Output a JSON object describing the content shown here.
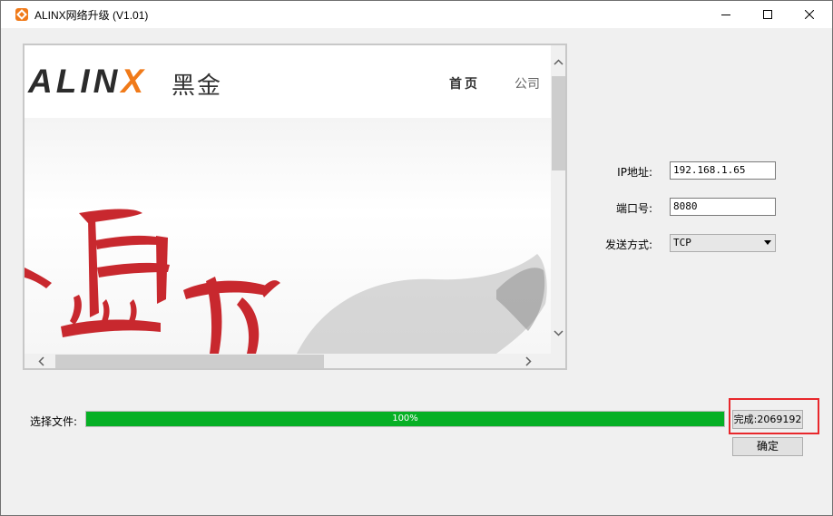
{
  "window": {
    "title": "ALINX网络升级 (V1.01)",
    "controls": {
      "minimize": "minimize",
      "maximize": "maximize",
      "close": "close"
    }
  },
  "browser": {
    "logo_text": "ALIN",
    "logo_x": "X",
    "logo_cn": "黑金",
    "nav": {
      "home": "首页",
      "company": "公司"
    }
  },
  "form": {
    "ip_label": "IP地址:",
    "ip_value": "192.168.1.65",
    "port_label": "端口号:",
    "port_value": "8080",
    "mode_label": "发送方式:",
    "mode_value": "TCP"
  },
  "upgrade": {
    "file_label": "选择文件:",
    "progress_text": "100%",
    "progress_value": 1.0,
    "status_text": "完成:2069192",
    "ok_label": "确定"
  },
  "colors": {
    "accent": "#f07a19",
    "progress_fill": "#06b025",
    "highlight": "#e8272b"
  }
}
